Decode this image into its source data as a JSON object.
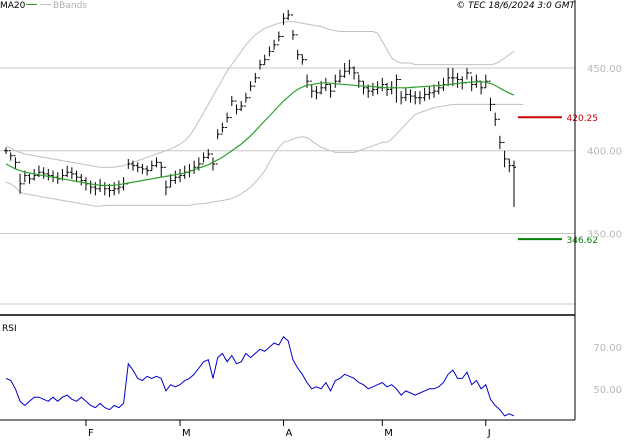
{
  "header": {
    "legend_ma": "MA20",
    "legend_bb": "BBands",
    "copyright": "© TEC 18/6/2024 3:0 GMT"
  },
  "colors": {
    "price": "#000000",
    "ma": "#2ca02c",
    "bands": "#c0c0c0",
    "rsi": "#0000cc",
    "resistance": "#cc0000",
    "support": "#008000",
    "grid": "#c8c8c8",
    "axis": "#000000",
    "tick_label": "#b8b8b8"
  },
  "chart_data": [
    {
      "type": "ohlc",
      "name": "price-panel",
      "ylim": [
        305,
        485
      ],
      "y_ticks": [
        350,
        400,
        450
      ],
      "y_tick_labels": [
        "350.00",
        "400.00",
        "450.00"
      ],
      "x_ticks": [
        {
          "label": "F",
          "index": 17
        },
        {
          "label": "M",
          "index": 37
        },
        {
          "label": "A",
          "index": 59
        },
        {
          "label": "M",
          "index": 80
        },
        {
          "label": "J",
          "index": 102
        }
      ],
      "close": [
        400,
        397,
        393,
        380,
        385,
        383,
        385,
        387,
        386,
        385,
        384,
        383,
        385,
        387,
        386,
        384,
        382,
        380,
        378,
        377,
        379,
        377,
        376,
        377,
        378,
        380,
        392,
        391,
        390,
        389,
        388,
        391,
        393,
        390,
        378,
        382,
        384,
        385,
        387,
        388,
        390,
        392,
        396,
        398,
        392,
        410,
        414,
        420,
        430,
        425,
        427,
        432,
        439,
        444,
        452,
        455,
        460,
        464,
        469,
        480,
        482,
        470,
        458,
        455,
        442,
        436,
        435,
        438,
        440,
        436,
        442,
        445,
        448,
        450,
        447,
        442,
        438,
        436,
        437,
        438,
        440,
        437,
        438,
        443,
        432,
        434,
        433,
        432,
        432,
        434,
        435,
        436,
        438,
        440,
        444,
        444,
        443,
        441,
        447,
        440,
        442,
        438,
        442,
        428,
        419,
        405,
        395,
        391,
        390
      ],
      "high": [
        402,
        399,
        396,
        386,
        388,
        386,
        389,
        391,
        390,
        389,
        388,
        387,
        389,
        391,
        390,
        388,
        386,
        384,
        382,
        381,
        383,
        381,
        380,
        381,
        382,
        384,
        395,
        394,
        393,
        392,
        391,
        394,
        396,
        393,
        382,
        386,
        388,
        389,
        391,
        392,
        394,
        396,
        399,
        401,
        396,
        413,
        417,
        423,
        433,
        428,
        430,
        435,
        442,
        447,
        455,
        458,
        463,
        467,
        472,
        483,
        485,
        473,
        461,
        458,
        446,
        440,
        439,
        442,
        444,
        440,
        446,
        449,
        453,
        455,
        451,
        446,
        442,
        440,
        441,
        442,
        444,
        441,
        442,
        446,
        436,
        438,
        437,
        436,
        436,
        438,
        439,
        440,
        442,
        444,
        450,
        450,
        447,
        445,
        450,
        445,
        446,
        442,
        446,
        432,
        423,
        409,
        400,
        395,
        394
      ],
      "low": [
        398,
        394,
        389,
        374,
        381,
        380,
        382,
        384,
        383,
        382,
        381,
        380,
        382,
        384,
        383,
        381,
        379,
        376,
        374,
        373,
        375,
        373,
        372,
        373,
        374,
        376,
        389,
        388,
        387,
        386,
        385,
        388,
        390,
        384,
        373,
        378,
        380,
        381,
        383,
        384,
        386,
        388,
        393,
        395,
        388,
        407,
        411,
        417,
        427,
        422,
        424,
        429,
        436,
        441,
        449,
        452,
        457,
        461,
        466,
        476,
        479,
        467,
        455,
        452,
        438,
        432,
        431,
        434,
        436,
        432,
        438,
        441,
        444,
        446,
        443,
        438,
        434,
        432,
        433,
        434,
        436,
        433,
        434,
        429,
        428,
        430,
        429,
        428,
        428,
        430,
        431,
        432,
        434,
        436,
        439,
        439,
        438,
        437,
        443,
        436,
        438,
        434,
        438,
        424,
        415,
        401,
        390,
        387,
        366
      ],
      "ma20": [
        392,
        390.5,
        389,
        388,
        387,
        386.5,
        386,
        385.5,
        385,
        384.5,
        384,
        383.5,
        383,
        382.5,
        382,
        381.5,
        381,
        380.5,
        380,
        379.5,
        379.2,
        379,
        379,
        379.2,
        379.5,
        380,
        380.5,
        381,
        381.5,
        382,
        382.5,
        383,
        383.5,
        384,
        384.5,
        385,
        385.5,
        386,
        386.5,
        387.5,
        388.5,
        389.5,
        390.5,
        391.5,
        393,
        394.5,
        396,
        398,
        400,
        402,
        404,
        406.5,
        409,
        412,
        415,
        418,
        421,
        424,
        427,
        430,
        432.5,
        435,
        437,
        438.5,
        439.5,
        440,
        440.5,
        441,
        441,
        440.8,
        440.5,
        440.2,
        440,
        439.8,
        439.5,
        439.2,
        439,
        439,
        438.8,
        438.5,
        438.2,
        438,
        438,
        438,
        438,
        438,
        438.2,
        438.4,
        438.6,
        438.8,
        439,
        439.2,
        439.4,
        439.6,
        440,
        440.3,
        440.6,
        441,
        441.3,
        441.5,
        441.7,
        441.6,
        441.4,
        440.6,
        439.4,
        437.8,
        436.2,
        434.8,
        433.6
      ],
      "bb_upper": [
        403,
        401.5,
        400,
        399,
        398,
        397.5,
        397,
        396.5,
        396,
        395.5,
        395,
        394.5,
        394,
        393.5,
        393,
        392.5,
        392,
        391.5,
        391,
        390.5,
        390,
        390,
        390,
        390,
        390.5,
        391,
        392,
        393,
        394,
        395,
        396,
        397,
        398,
        399,
        400,
        401,
        402.5,
        404,
        406,
        409,
        413,
        418,
        423,
        428,
        433,
        438,
        443,
        448,
        452,
        456,
        460,
        464,
        467,
        470,
        472,
        474,
        475,
        476,
        477,
        477.5,
        478,
        478,
        477.5,
        477,
        476.5,
        476,
        475.5,
        475,
        474,
        473,
        472.5,
        472,
        472,
        472,
        472,
        472,
        472,
        472,
        472,
        471,
        466,
        461,
        456,
        454,
        453,
        453,
        453,
        452,
        452,
        452,
        452,
        452,
        452,
        452,
        452,
        452,
        452,
        452,
        452,
        452,
        452,
        452,
        452,
        452,
        452.5,
        454,
        456,
        458,
        460
      ],
      "bb_lower": [
        381,
        380,
        378,
        375,
        374,
        373.5,
        373,
        372.5,
        372,
        371.5,
        371,
        370.5,
        370,
        369.5,
        369,
        368.5,
        368,
        367.5,
        367,
        366.5,
        366.5,
        367,
        367,
        367,
        367,
        367,
        367,
        367,
        367,
        367,
        367,
        367,
        367,
        367,
        367,
        367,
        367,
        367,
        367,
        367,
        367.5,
        368,
        368,
        368.5,
        369,
        369.5,
        370,
        370.5,
        371,
        372.5,
        374,
        376,
        378,
        381,
        384,
        388,
        393,
        398,
        402,
        405,
        406,
        407,
        408,
        408.5,
        408,
        406,
        404,
        402,
        401,
        400,
        399,
        399,
        399,
        399,
        399,
        400,
        401,
        402,
        403,
        404,
        405,
        405,
        407,
        410,
        413,
        416,
        419,
        422,
        423,
        424,
        425,
        426,
        426.5,
        427,
        427.5,
        428,
        428,
        428,
        428,
        428,
        428,
        428,
        428,
        428,
        428,
        428,
        428,
        428,
        428,
        428,
        428
      ],
      "levels": [
        {
          "label": "420.25",
          "value": 420.25,
          "color": "#cc0000"
        },
        {
          "label": "346.62",
          "value": 346.62,
          "color": "#008000"
        }
      ]
    },
    {
      "type": "line",
      "name": "rsi-panel",
      "title": "RSI",
      "ylim": [
        36,
        84
      ],
      "y_ticks": [
        50,
        70
      ],
      "y_tick_labels": [
        "50.00",
        "70.00"
      ],
      "rsi": [
        55,
        54,
        50,
        44,
        42,
        44,
        46,
        46,
        45,
        44,
        46,
        44,
        46,
        47,
        45,
        44,
        46,
        44,
        42,
        41,
        43,
        41,
        40,
        42,
        41,
        43,
        62,
        59,
        55,
        54,
        56,
        55,
        56,
        55,
        49,
        52,
        51,
        52,
        54,
        55,
        57,
        60,
        63,
        64,
        55,
        65,
        67,
        63,
        66,
        62,
        63,
        67,
        65,
        67,
        69,
        68,
        70,
        72,
        71,
        75,
        73,
        64,
        60,
        57,
        53,
        50,
        51,
        50,
        53,
        49,
        54,
        55,
        57,
        56,
        55,
        53,
        52,
        50,
        51,
        52,
        53,
        51,
        52,
        50,
        47,
        49,
        48,
        47,
        48,
        49,
        50,
        50,
        51,
        53,
        57,
        59,
        55,
        55,
        58,
        52,
        54,
        50,
        52,
        45,
        42,
        40,
        37,
        38,
        37
      ]
    }
  ]
}
